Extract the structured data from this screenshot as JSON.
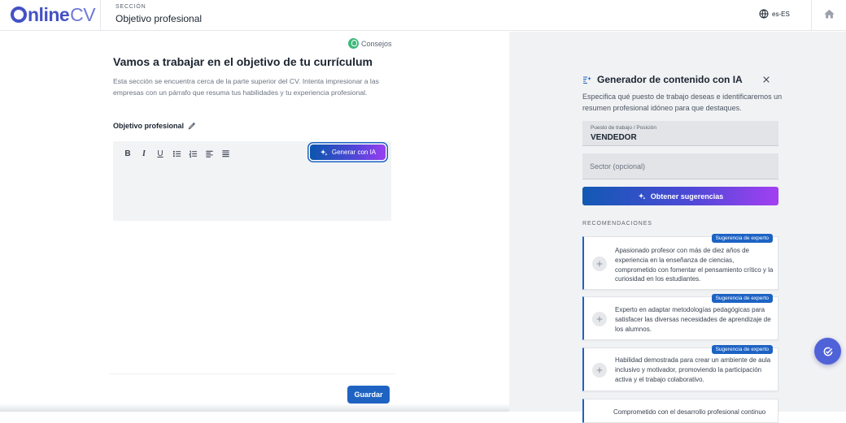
{
  "header": {
    "logo_main": "nline",
    "logo_suffix": "CV",
    "section_eyebrow": "SECCIÓN",
    "section_title": "Objetivo profesional",
    "language": "es-ES"
  },
  "editor_panel": {
    "tips_label": "Consejos",
    "title": "Vamos a trabajar en el objetivo de tu currículum",
    "description": "Esta sección se encuentra cerca de la parte superior del CV. Intenta impresionar a las empresas con un párrafo que resuma tus habilidades y tu experiencia profesional.",
    "field_label": "Objetivo profesional",
    "toolbar": {
      "bold": "B",
      "italic": "I",
      "underline": "U"
    },
    "ai_button_label": "Generar con IA",
    "save_label": "Guardar"
  },
  "ai_panel": {
    "title": "Generador de contenido con IA",
    "description": "Especifica qué puesto de trabajo deseas e identificaremos un resumen profesional idóneo para que destaques.",
    "job_field_label": "Puesto de trabajo / Posición",
    "job_field_value": "VENDEDOR",
    "sector_placeholder": "Sector (opcional)",
    "suggest_button_label": "Obtener sugerencias",
    "recommendations_heading": "RECOMENDACIONES",
    "recommendations": [
      {
        "badge": "Sugerencia de experto",
        "text": "Apasionado profesor con más de diez años de experiencia en la enseñanza de ciencias, comprometido con fomentar el pensamiento crítico y la curiosidad en los estudiantes."
      },
      {
        "badge": "Sugerencia de experto",
        "text": "Experto en adaptar metodologías pedagógicas para satisfacer las diversas necesidades de aprendizaje de los alumnos."
      },
      {
        "badge": "Sugerencia de experto",
        "text": "Habilidad demostrada para crear un ambiente de aula inclusivo y motivador, promoviendo la participación activa y el trabajo colaborativo."
      },
      {
        "text": "Comprometido con el desarrollo profesional continuo"
      }
    ]
  },
  "colors": {
    "brand": "#4452c4",
    "primary_button": "#1f63c2",
    "card_accent": "#1d63c4",
    "tips_green": "#3fba7c"
  }
}
